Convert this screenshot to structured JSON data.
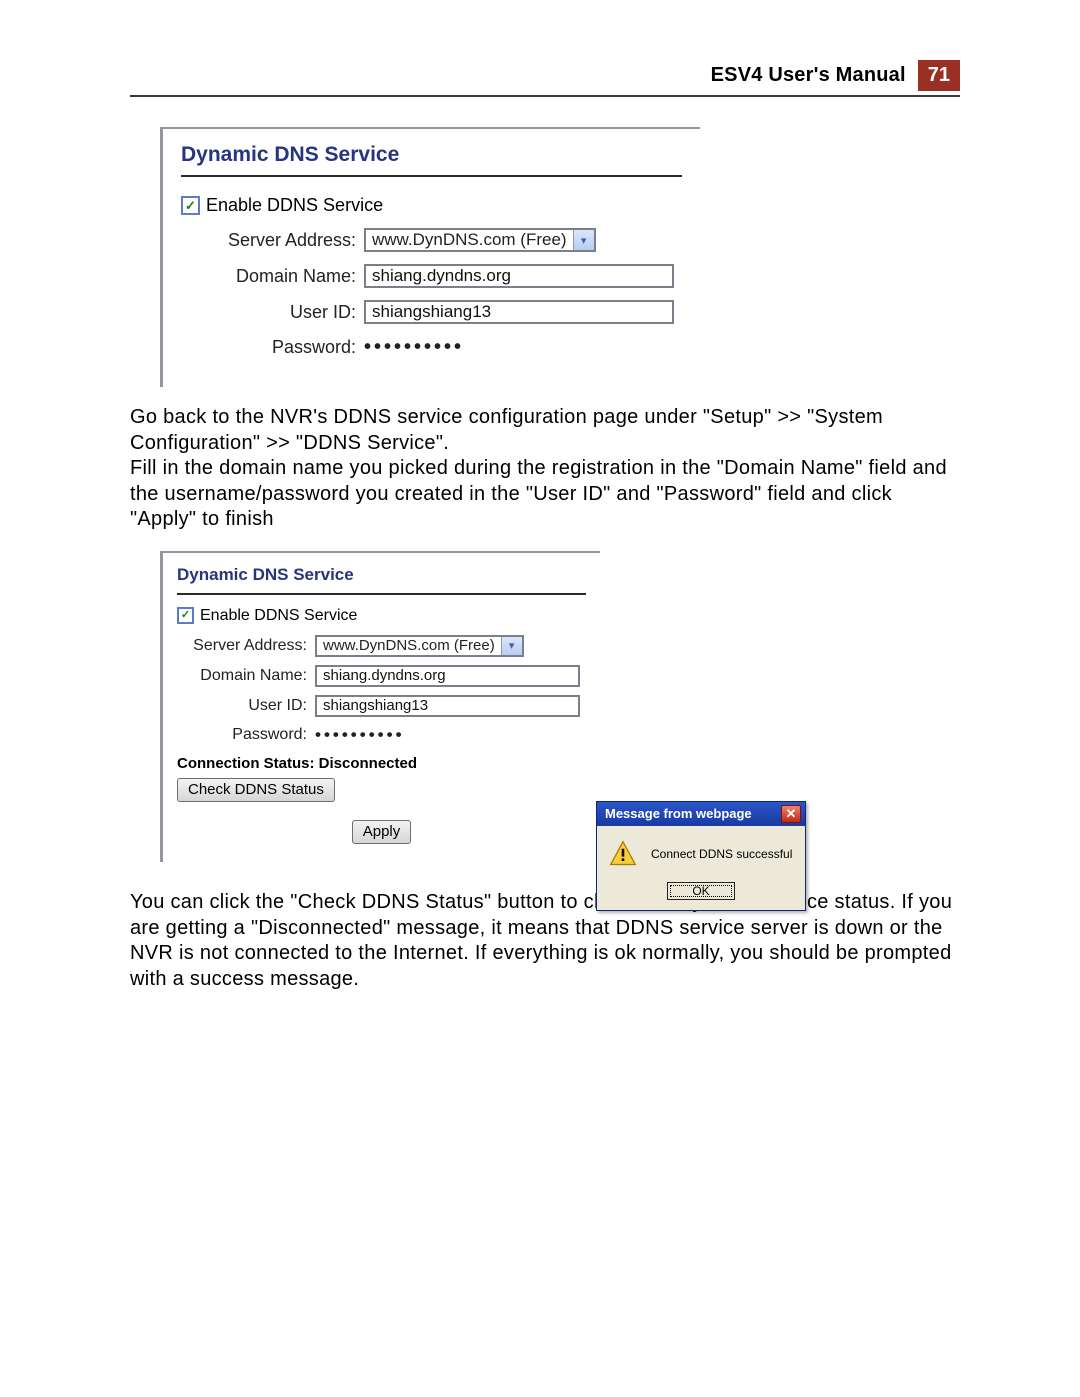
{
  "header": {
    "title": "ESV4 User's Manual",
    "page_number": "71"
  },
  "paragraph1": "Go back to the NVR's DDNS service configuration page under \"Setup\" >> \"System Configuration\" >> \"DDNS Service\".\nFill in the domain name you picked during the registration in the \"Domain Name\" field and the username/password you created in the \"User ID\" and \"Password\" field and click \"Apply\" to finish",
  "paragraph2": "You can click the \"Check DDNS Status\" button to check the DynDNS service status. If you are getting a \"Disconnected\" message, it means that DDNS service server is down or the NVR is not connected to the Internet. If everything is ok normally, you should be prompted with a success message.",
  "panel_title": "Dynamic DNS Service",
  "enable_label": "Enable DDNS Service",
  "labels": {
    "server_address": "Server Address:",
    "domain_name": "Domain Name:",
    "user_id": "User ID:",
    "password": "Password:"
  },
  "values": {
    "server_address_selected": "www.DynDNS.com (Free)",
    "domain_name": "shiang.dyndns.org",
    "user_id": "shiangshiang13",
    "password_mask": "••••••••••"
  },
  "status": {
    "connection_label": "Connection Status:",
    "connection_value": "Disconnected",
    "check_button": "Check DDNS Status",
    "apply_button": "Apply"
  },
  "popup": {
    "title": "Message from webpage",
    "message": "Connect DDNS successful",
    "ok": "OK"
  }
}
